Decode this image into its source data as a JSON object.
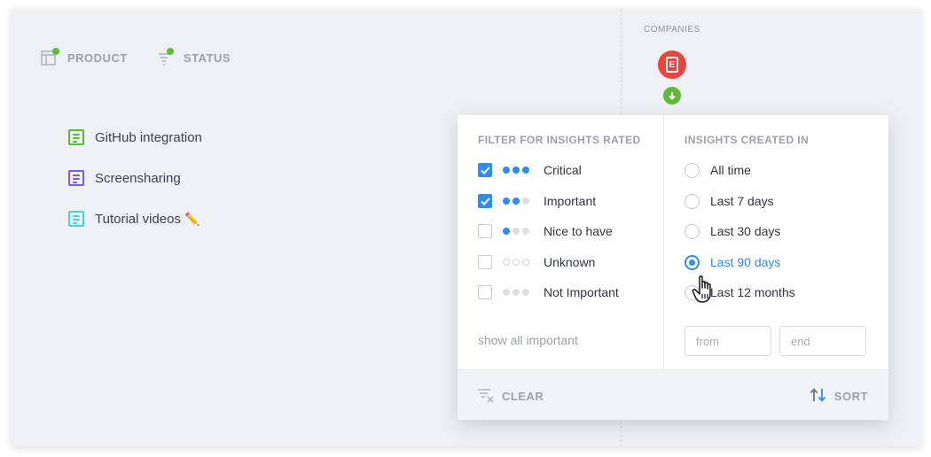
{
  "topbar": {
    "product_label": "PRODUCT",
    "status_label": "STATUS"
  },
  "products": [
    {
      "name": "GitHub integration",
      "color": "#5dbb3a"
    },
    {
      "name": "Screensharing",
      "color": "#7b5ce1"
    },
    {
      "name": "Tutorial videos",
      "color": "#4fd0d6",
      "emoji": "✏️"
    }
  ],
  "companies": {
    "label": "COMPANIES",
    "avatar_letter": "E",
    "avatar_color": "#e8453c"
  },
  "filter": {
    "rated_title": "FILTER FOR INSIGHTS RATED",
    "ratings": [
      {
        "label": "Critical",
        "checked": true,
        "level": 3
      },
      {
        "label": "Important",
        "checked": true,
        "level": 2
      },
      {
        "label": "Nice to have",
        "checked": false,
        "level": 1
      },
      {
        "label": "Unknown",
        "checked": false,
        "level": 0
      },
      {
        "label": "Not Important",
        "checked": false,
        "level": -1
      }
    ],
    "show_all": "show all important",
    "created_title": "INSIGHTS CREATED IN",
    "periods": [
      {
        "label": "All time",
        "selected": false
      },
      {
        "label": "Last 7 days",
        "selected": false
      },
      {
        "label": "Last 30 days",
        "selected": false
      },
      {
        "label": "Last 90 days",
        "selected": true
      },
      {
        "label": "Last 12 months",
        "selected": false
      }
    ],
    "from_placeholder": "from",
    "end_placeholder": "end",
    "clear_label": "CLEAR",
    "sort_label": "SORT"
  },
  "colors": {
    "accent": "#2f8cf0",
    "green": "#5dbb3a"
  }
}
